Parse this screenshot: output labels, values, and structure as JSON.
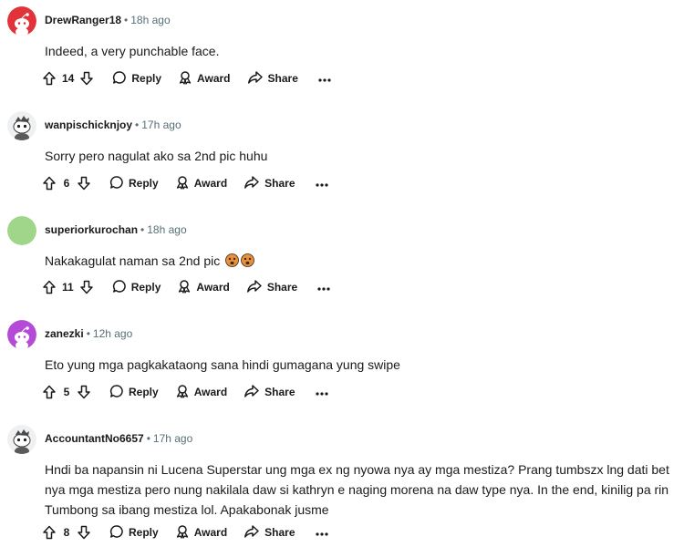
{
  "actions": {
    "reply": "Reply",
    "award": "Award",
    "share": "Share"
  },
  "comments": [
    {
      "username": "DrewRanger18",
      "time": "18h ago",
      "text": "Indeed, a very punchable face.",
      "votes": "14",
      "avatar": "red-snoo-avatar"
    },
    {
      "username": "wanpischicknjoy",
      "time": "17h ago",
      "text": "Sorry pero nagulat ako sa 2nd pic huhu",
      "votes": "6",
      "avatar": "custom-snoo-avatar"
    },
    {
      "username": "superiorkurochan",
      "time": "18h ago",
      "text": "Nakakagulat naman sa 2nd pic",
      "votes": "11",
      "avatar": "green-circle-avatar"
    },
    {
      "username": "zanezki",
      "time": "12h ago",
      "text": "Eto yung mga pagkakataong sana hindi gumagana yung swipe",
      "votes": "5",
      "avatar": "purple-snoo-avatar"
    },
    {
      "username": "AccountantNo6657",
      "time": "17h ago",
      "text_lines": [
        "Hndi ba napansin ni Lucena Superstar ung mga ex ng nyowa nya ay mga mestiza? Prang tumbszx lng dati bet",
        "nya mga mestiza pero nung nakilala daw si kathryn e naging morena na daw type nya. In the end, kinilig pa rin",
        "Tumbong sa ibang mestiza lol. Apakabonak jusme"
      ],
      "votes": "8",
      "avatar": "custom-snoo-avatar"
    }
  ],
  "colors": {
    "text": "#1a1a1b",
    "meta": "#576f76",
    "avatar_red": "#e0343a",
    "avatar_green": "#9fd68a",
    "avatar_purple": "#b54ad6"
  }
}
